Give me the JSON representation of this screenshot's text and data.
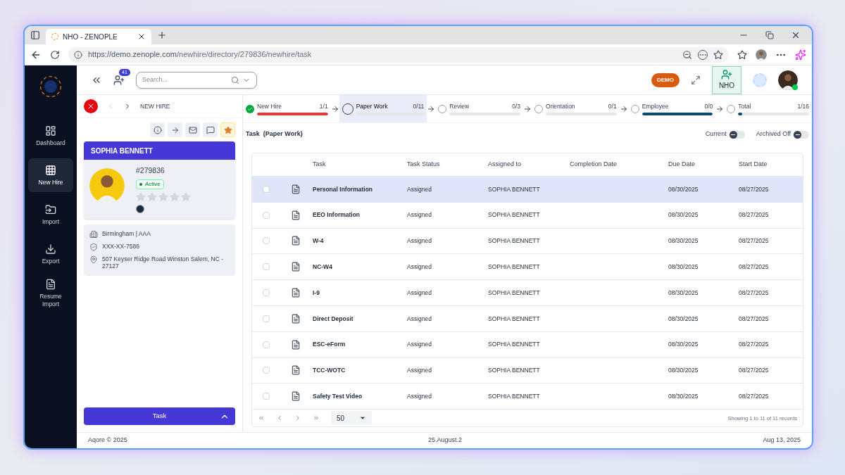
{
  "browser": {
    "tab_title": "NHO - ZENOPLE",
    "url_host": "https://demo.zenople.com",
    "url_path": "/newhire/directory/279836/newhire/task"
  },
  "sidebar": {
    "items": [
      {
        "label": "Dashboard",
        "selected": false
      },
      {
        "label": "New Hire",
        "selected": true
      },
      {
        "label": "Import",
        "selected": false
      },
      {
        "label": "Export",
        "selected": false
      },
      {
        "label": "Resume Import",
        "selected": false
      }
    ]
  },
  "header": {
    "badge_count": "41",
    "search": {
      "placeholder": "Search..."
    },
    "demo_badge": "DEMO",
    "nho_label": "NHO"
  },
  "profile_panel": {
    "section": "NEW HIRE",
    "name": "SOPHIA BENNETT",
    "id": "#279836",
    "status": "Active",
    "stars": 0,
    "details": [
      {
        "kind": "building",
        "text": "Birmingham | AAA"
      },
      {
        "kind": "shield",
        "text": "XXX-XX-7586"
      },
      {
        "kind": "pin",
        "text": "507 Keyser Ridge Road Winston Salem, NC - 27127"
      }
    ],
    "task_button": "Task"
  },
  "stages": [
    {
      "label": "New Hire",
      "count": "1/1",
      "done": true,
      "selected": false,
      "level": 1,
      "color": "#dc3b3b"
    },
    {
      "label": "Paper Work",
      "count": "0/11",
      "done": false,
      "selected": true
    },
    {
      "label": "Review",
      "count": "0/3",
      "done": false,
      "selected": false
    },
    {
      "label": "Orientation",
      "count": "0/1",
      "done": false,
      "selected": false
    },
    {
      "label": "Employee",
      "count": "0/0",
      "done": false,
      "selected": false,
      "level": 1,
      "color": "#0c4a6e"
    },
    {
      "label": "Total",
      "count": "1/16",
      "done": false,
      "selected": false,
      "level": 0.06,
      "color": "#0c4a6e"
    }
  ],
  "task_title": "Task  (Paper Work)",
  "toggles": [
    {
      "label": "Current",
      "on": false
    },
    {
      "label": "Archived Off",
      "on": false
    }
  ],
  "table": {
    "columns": [
      "Task",
      "Task Status",
      "Assigned to",
      "Completion Date",
      "Due Date",
      "Start Date"
    ],
    "rows": [
      {
        "task": "Personal Information",
        "status": "Assigned",
        "assigned": "SOPHIA BENNETT",
        "due": "08/30/2025",
        "start": "08/27/2025",
        "selected": true,
        "checked": false
      },
      {
        "task": "EEO Information",
        "status": "Assigned",
        "assigned": "SOPHIA BENNETT",
        "due": "08/30/2025",
        "start": "08/27/2025",
        "selected": false,
        "checked": false
      },
      {
        "task": "W-4",
        "status": "Assigned",
        "assigned": "SOPHIA BENNETT",
        "due": "08/30/2025",
        "start": "08/27/2025",
        "selected": false,
        "checked": false
      },
      {
        "task": "NC-W4",
        "status": "Assigned",
        "assigned": "SOPHIA BENNETT",
        "due": "08/30/2025",
        "start": "08/27/2025",
        "selected": false,
        "checked": false
      },
      {
        "task": "I-9",
        "status": "Assigned",
        "assigned": "SOPHIA BENNETT",
        "due": "08/30/2025",
        "start": "08/27/2025",
        "selected": false,
        "checked": false
      },
      {
        "task": "Direct Deposit",
        "status": "Assigned",
        "assigned": "SOPHIA BENNETT",
        "due": "08/30/2025",
        "start": "08/27/2025",
        "selected": false,
        "checked": false
      },
      {
        "task": "ESC-eForm",
        "status": "Assigned",
        "assigned": "SOPHIA BENNETT",
        "due": "08/30/2025",
        "start": "08/27/2025",
        "selected": false,
        "checked": false
      },
      {
        "task": "TCC-WOTC",
        "status": "Assigned",
        "assigned": "SOPHIA BENNETT",
        "due": "08/30/2025",
        "start": "08/27/2025",
        "selected": false,
        "checked": false
      },
      {
        "task": "Safety Test Video",
        "status": "Assigned",
        "assigned": "SOPHIA BENNETT",
        "due": "08/30/2025",
        "start": "08/27/2025",
        "selected": false,
        "checked": false
      }
    ],
    "page_size": "50",
    "records": "Showing 1 to 11 of 11 records"
  },
  "footer": {
    "left": "Aqore © 2025",
    "center": "25.August.2",
    "right": "Aug 13, 2025"
  }
}
